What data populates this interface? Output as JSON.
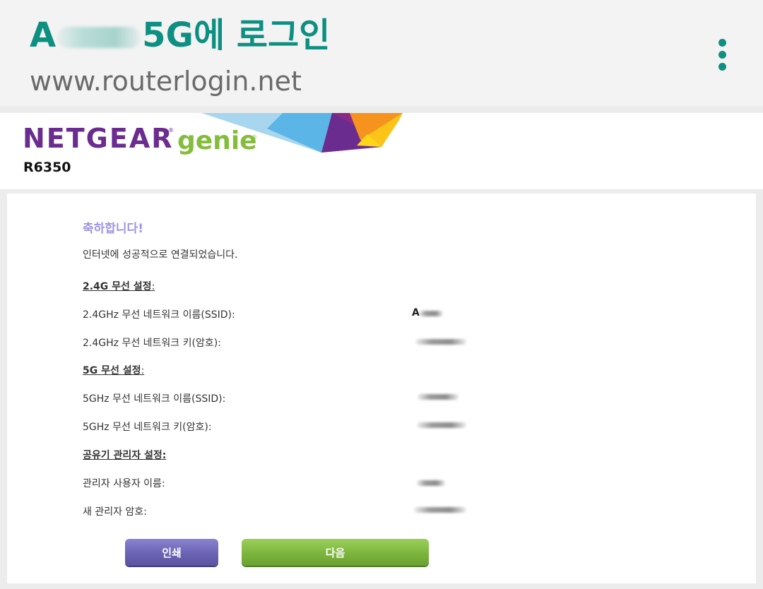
{
  "header": {
    "title_prefix": "A",
    "title_suffix": "5G에 로그인",
    "url": "www.routerlogin.net",
    "menu_icon": "more-vert-icon",
    "accent_color": "#0d8f81"
  },
  "banner": {
    "logo_brand": "NETGEAR",
    "logo_product": "genie",
    "logo_registered": "®",
    "model": "R6350",
    "brand_color": "#6b2c8f",
    "product_color": "#84bd3c"
  },
  "main": {
    "congrats": "축하합니다!",
    "connected_msg": "인터넷에 성공적으로 연결되었습니다.",
    "wireless_24": {
      "heading": "2.4G 무선 설정",
      "heading_colon": ":",
      "ssid_label": "2.4GHz 무선 네트워크 이름(SSID):",
      "key_label": "2.4GHz 무선 네트워크 키(암호):",
      "ssid_value_visible": "A"
    },
    "wireless_5": {
      "heading": "5G 무선 설정",
      "heading_colon": ":",
      "ssid_label": "5GHz 무선 네트워크 이름(SSID):",
      "key_label": "5GHz 무선 네트워크 키(암호):"
    },
    "admin": {
      "heading": "공유기 관리자 설정:",
      "user_label": "관리자 사용자 이름:",
      "password_label": "새 관리자 암호:"
    }
  },
  "buttons": {
    "print": "인쇄",
    "next": "다음"
  }
}
